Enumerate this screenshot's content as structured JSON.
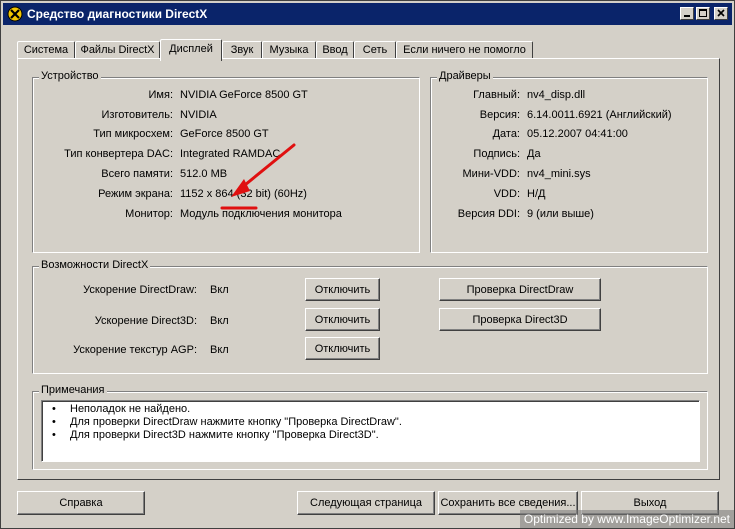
{
  "window": {
    "title": "Средство диагностики DirectX"
  },
  "tabs": [
    "Система",
    "Файлы DirectX",
    "Дисплей",
    "Звук",
    "Музыка",
    "Ввод",
    "Сеть",
    "Если ничего не помогло"
  ],
  "active_tab": "Дисплей",
  "device": {
    "label": "Устройство",
    "rows": [
      {
        "label": "Имя:",
        "value": "NVIDIA GeForce 8500 GT"
      },
      {
        "label": "Изготовитель:",
        "value": "NVIDIA"
      },
      {
        "label": "Тип микросхем:",
        "value": "GeForce 8500 GT"
      },
      {
        "label": "Тип конвертера DAC:",
        "value": "Integrated RAMDAC"
      },
      {
        "label": "Всего памяти:",
        "value": "512.0 MB"
      },
      {
        "label": "Режим экрана:",
        "value": "1152 x 864 (32 bit) (60Hz)"
      },
      {
        "label": "Монитор:",
        "value": "Модуль подключения монитора"
      }
    ]
  },
  "drivers": {
    "label": "Драйверы",
    "rows": [
      {
        "label": "Главный:",
        "value": "nv4_disp.dll"
      },
      {
        "label": "Версия:",
        "value": "6.14.0011.6921 (Английский)"
      },
      {
        "label": "Дата:",
        "value": "05.12.2007 04:41:00"
      },
      {
        "label": "Подпись:",
        "value": "Да"
      },
      {
        "label": "Мини-VDD:",
        "value": "nv4_mini.sys"
      },
      {
        "label": "VDD:",
        "value": "Н/Д"
      },
      {
        "label": "Версия DDI:",
        "value": "9 (или выше)"
      }
    ]
  },
  "features": {
    "label": "Возможности DirectX",
    "rows": [
      {
        "label": "Ускорение DirectDraw:",
        "value": "Вкл",
        "button": "Отключить"
      },
      {
        "label": "Ускорение Direct3D:",
        "value": "Вкл",
        "button": "Отключить"
      },
      {
        "label": "Ускорение текстур AGP:",
        "value": "Вкл",
        "button": "Отключить"
      }
    ],
    "test_buttons": [
      "Проверка DirectDraw",
      "Проверка Direct3D"
    ]
  },
  "notes": {
    "label": "Примечания",
    "items": [
      "Неполадок не найдено.",
      "Для проверки DirectDraw нажмите кнопку \"Проверка DirectDraw\".",
      "Для проверки Direct3D нажмите кнопку \"Проверка Direct3D\"."
    ]
  },
  "bottom_buttons": {
    "help": "Справка",
    "next_page": "Следующая страница",
    "save_all": "Сохранить все сведения...",
    "exit": "Выход"
  },
  "annotation": {
    "color": "#e01010"
  },
  "watermark": "Optimized by www.ImageOptimizer.net"
}
